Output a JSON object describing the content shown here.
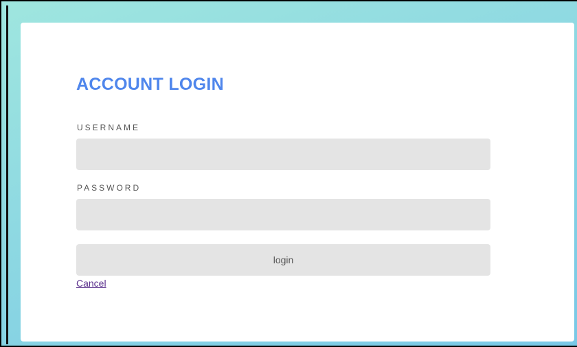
{
  "login_form": {
    "title": "ACCOUNT LOGIN",
    "username_label": "USERNAME",
    "username_value": "",
    "password_label": "PASSWORD",
    "password_value": "",
    "login_button_label": "login",
    "cancel_link_label": "Cancel"
  },
  "colors": {
    "title": "#4f86ec",
    "input_background": "#e4e4e4",
    "link": "#5a2f8c",
    "background_gradient_start": "#9fe6df",
    "background_gradient_end": "#79c8e6"
  }
}
